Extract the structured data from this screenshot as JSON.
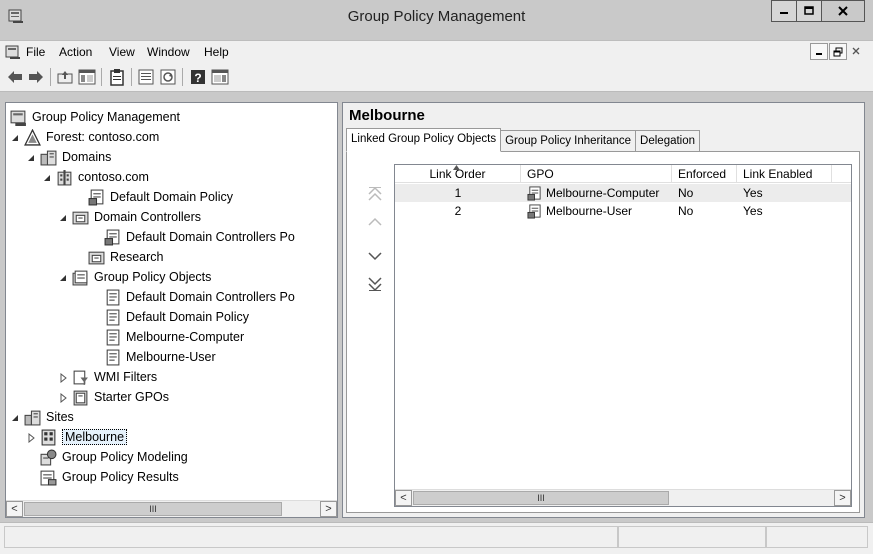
{
  "window": {
    "title": "Group Policy Management",
    "colors": {
      "titlebar": "#c9c9c9",
      "pane_border": "#828790",
      "selection": "#e5f1fb"
    }
  },
  "menu": {
    "items": [
      "File",
      "Action",
      "View",
      "Window",
      "Help"
    ]
  },
  "tree": {
    "items": [
      {
        "label": "Group Policy Management",
        "icon": "gpm-console-icon",
        "expander": "none"
      },
      {
        "label": "Forest: contoso.com",
        "icon": "forest-icon",
        "expander": "expanded"
      },
      {
        "label": "Domains",
        "icon": "domains-icon",
        "expander": "expanded"
      },
      {
        "label": "contoso.com",
        "icon": "domain-icon",
        "expander": "expanded"
      },
      {
        "label": "Default Domain Policy",
        "icon": "gpo-link-icon",
        "expander": "none"
      },
      {
        "label": "Domain Controllers",
        "icon": "ou-icon",
        "expander": "expanded"
      },
      {
        "label": "Default Domain Controllers Po",
        "icon": "gpo-link-icon",
        "expander": "none"
      },
      {
        "label": "Research",
        "icon": "ou-icon",
        "expander": "none"
      },
      {
        "label": "Group Policy Objects",
        "icon": "gpo-container-icon",
        "expander": "expanded"
      },
      {
        "label": "Default Domain Controllers Po",
        "icon": "gpo-icon",
        "expander": "none"
      },
      {
        "label": "Default Domain Policy",
        "icon": "gpo-icon",
        "expander": "none"
      },
      {
        "label": "Melbourne-Computer",
        "icon": "gpo-icon",
        "expander": "none"
      },
      {
        "label": "Melbourne-User",
        "icon": "gpo-icon",
        "expander": "none"
      },
      {
        "label": "WMI Filters",
        "icon": "wmi-filter-icon",
        "expander": "collapsed"
      },
      {
        "label": "Starter GPOs",
        "icon": "starter-gpo-icon",
        "expander": "collapsed"
      },
      {
        "label": "Sites",
        "icon": "sites-icon",
        "expander": "expanded"
      },
      {
        "label": "Melbourne",
        "icon": "site-icon",
        "expander": "collapsed",
        "selected": true
      },
      {
        "label": "Group Policy Modeling",
        "icon": "modeling-icon",
        "expander": "none"
      },
      {
        "label": "Group Policy Results",
        "icon": "results-icon",
        "expander": "none"
      }
    ],
    "scroll_thumb": "III"
  },
  "details": {
    "title": "Melbourne",
    "tabs": [
      "Linked Group Policy Objects",
      "Group Policy Inheritance",
      "Delegation"
    ],
    "columns": [
      "Link Order",
      "GPO",
      "Enforced",
      "Link Enabled"
    ],
    "rows": [
      {
        "order": "1",
        "gpo": "Melbourne-Computer",
        "enforced": "No",
        "enabled": "Yes"
      },
      {
        "order": "2",
        "gpo": "Melbourne-User",
        "enforced": "No",
        "enabled": "Yes"
      }
    ],
    "scroll_thumb": "III"
  }
}
